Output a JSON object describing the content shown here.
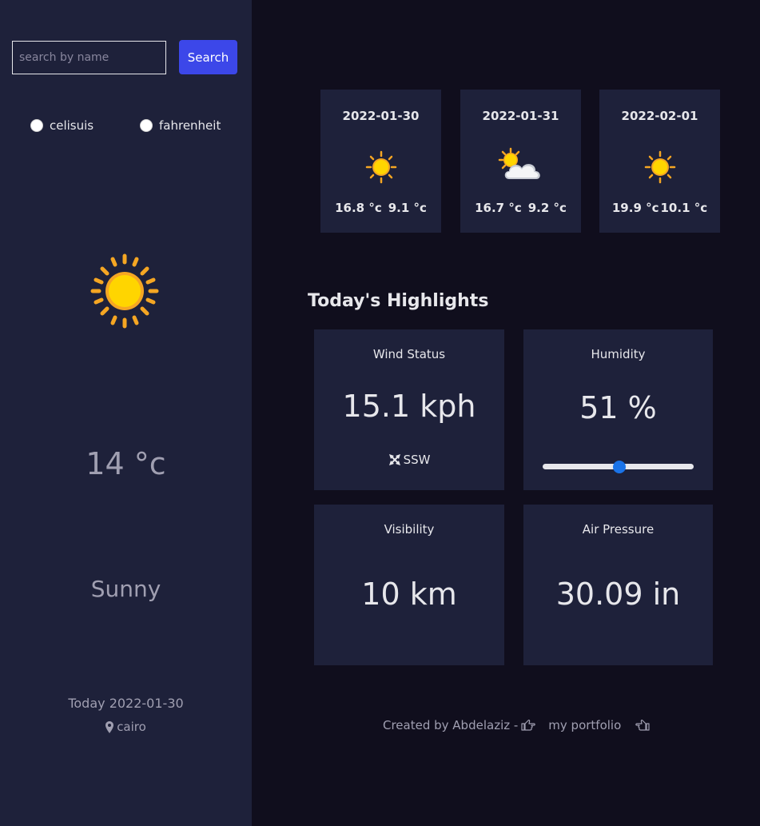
{
  "search": {
    "placeholder": "search by name",
    "button_label": "Search"
  },
  "units": {
    "celsius_label": "celisuis",
    "fahrenheit_label": "fahrenheit"
  },
  "current": {
    "icon": "sun-icon",
    "temperature": "14 °c",
    "condition": "Sunny",
    "date_text": "Today 2022-01-30",
    "location": "cairo"
  },
  "forecast": [
    {
      "date": "2022-01-30",
      "icon": "sun-icon",
      "max": "16.8 °c",
      "min": "9.1 °c"
    },
    {
      "date": "2022-01-31",
      "icon": "partly-cloudy-icon",
      "max": "16.7 °c",
      "min": "9.2 °c"
    },
    {
      "date": "2022-02-01",
      "icon": "sun-icon",
      "max": "19.9 °c",
      "min": "10.1 °c"
    }
  ],
  "highlights": {
    "title": "Today's Highlights",
    "wind": {
      "label": "Wind Status",
      "value": "15.1 kph",
      "direction": "SSW"
    },
    "humidity": {
      "label": "Humidity",
      "value": "51 %",
      "percent": 51
    },
    "visibility": {
      "label": "Visibility",
      "value": "10 km"
    },
    "pressure": {
      "label": "Air Pressure",
      "value": "30.09 in"
    }
  },
  "footer": {
    "credit": "Created by Abdelaziz -",
    "link_label": "my portfolio"
  },
  "colors": {
    "sidebar_bg": "#1e213a",
    "page_bg": "#100e1d",
    "card_bg": "#1e213a",
    "accent_button": "#3c47e9",
    "slider_thumb": "#1a73e8"
  }
}
